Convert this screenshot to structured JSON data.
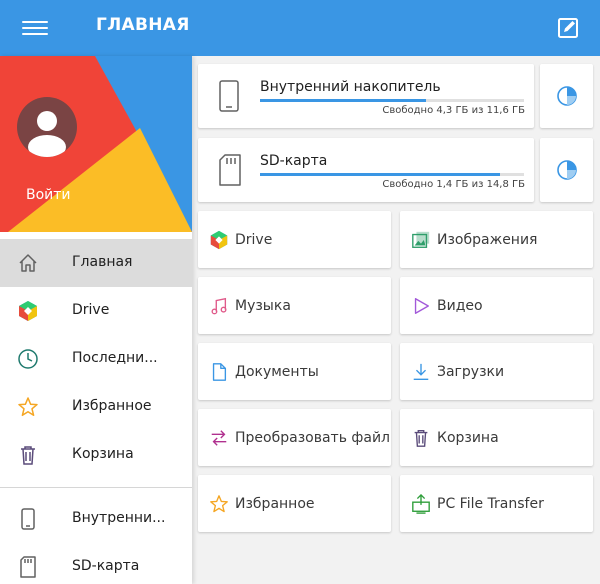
{
  "appbar": {
    "title": "ГЛАВНАЯ",
    "menu_icon": "hamburger-icon",
    "edit_icon": "edit-icon"
  },
  "drawer": {
    "login_label": "Войти",
    "items": [
      {
        "label": "Главная",
        "icon": "home-icon"
      },
      {
        "label": "Drive",
        "icon": "drive-icon"
      },
      {
        "label": "Последни...",
        "icon": "clock-icon"
      },
      {
        "label": "Избранное",
        "icon": "star-icon"
      },
      {
        "label": "Корзина",
        "icon": "trash-icon"
      },
      {
        "label": "Внутренни...",
        "icon": "phone-icon"
      },
      {
        "label": "SD-карта",
        "icon": "sdcard-icon"
      }
    ]
  },
  "storage": [
    {
      "name": "Внутренний накопитель",
      "info": "Свободно 4,3 ГБ из 11,6 ГБ",
      "used_fraction": 0.63,
      "icon": "phone-icon"
    },
    {
      "name": "SD-карта",
      "info": "Свободно 1,4 ГБ из 14,8 ГБ",
      "used_fraction": 0.91,
      "icon": "sdcard-icon"
    }
  ],
  "tiles": [
    {
      "label": "Drive",
      "icon": "drive-icon"
    },
    {
      "label": "Изображения",
      "icon": "images-icon"
    },
    {
      "label": "Музыка",
      "icon": "music-icon"
    },
    {
      "label": "Видео",
      "icon": "video-icon"
    },
    {
      "label": "Документы",
      "icon": "document-icon"
    },
    {
      "label": "Загрузки",
      "icon": "download-icon"
    },
    {
      "label": "Преобразовать файл",
      "icon": "convert-icon"
    },
    {
      "label": "Корзина",
      "icon": "trash-icon"
    },
    {
      "label": "Избранное",
      "icon": "star-icon"
    },
    {
      "label": "PC File Transfer",
      "icon": "pc-transfer-icon"
    }
  ],
  "colors": {
    "accent": "#3a96e4",
    "header_red": "#f04438",
    "header_yellow": "#fbbd26"
  }
}
